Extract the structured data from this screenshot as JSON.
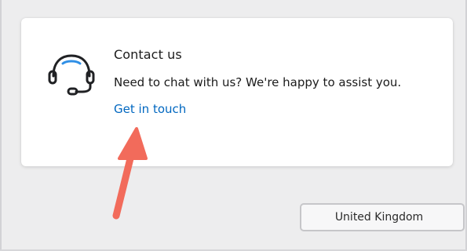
{
  "contact_card": {
    "title": "Contact us",
    "description": "Need to chat with us? We're happy to assist you.",
    "link_text": "Get in touch",
    "icon": "headset-icon"
  },
  "region_select": {
    "selected": "United Kingdom"
  },
  "annotation": {
    "type": "arrow",
    "color": "#f26b5b",
    "points_to": "Get in touch"
  },
  "colors": {
    "link": "#0067c0",
    "icon_accent": "#2f8fe6",
    "icon_stroke": "#202124",
    "background": "#ededee",
    "card": "#ffffff"
  }
}
